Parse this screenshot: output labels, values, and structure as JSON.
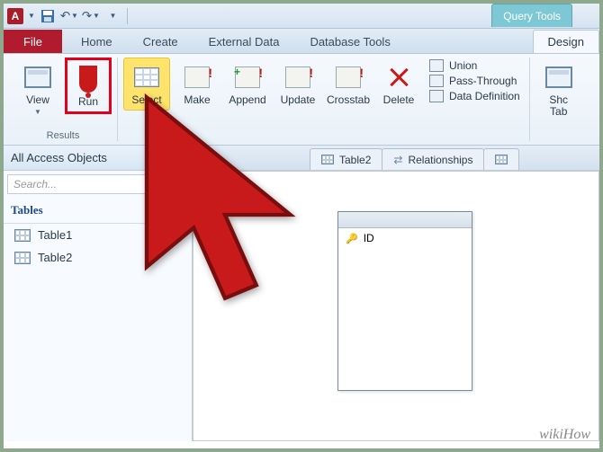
{
  "qat": {
    "save_tip": "Save"
  },
  "tabs": {
    "file": "File",
    "home": "Home",
    "create": "Create",
    "external": "External Data",
    "dbtools": "Database Tools",
    "design": "Design",
    "ctx_group": "Query Tools"
  },
  "ribbon": {
    "results_group": "Results",
    "view": "View",
    "run": "Run",
    "select": "Select",
    "make": "Make",
    "append": "Append",
    "update": "Update",
    "crosstab": "Crosstab",
    "delete": "Delete",
    "union": "Union",
    "passthrough": "Pass-Through",
    "datadef": "Data Definition",
    "show": "Shc",
    "tab": "Tab"
  },
  "nav": {
    "header": "All Access Objects",
    "search_placeholder": "Search...",
    "category": "Tables",
    "items": [
      "Table1",
      "Table2"
    ]
  },
  "doctabs": {
    "table2": "Table2",
    "relationships": "Relationships"
  },
  "fieldlist": {
    "pk_field": "ID"
  },
  "watermark": "wikiHow"
}
